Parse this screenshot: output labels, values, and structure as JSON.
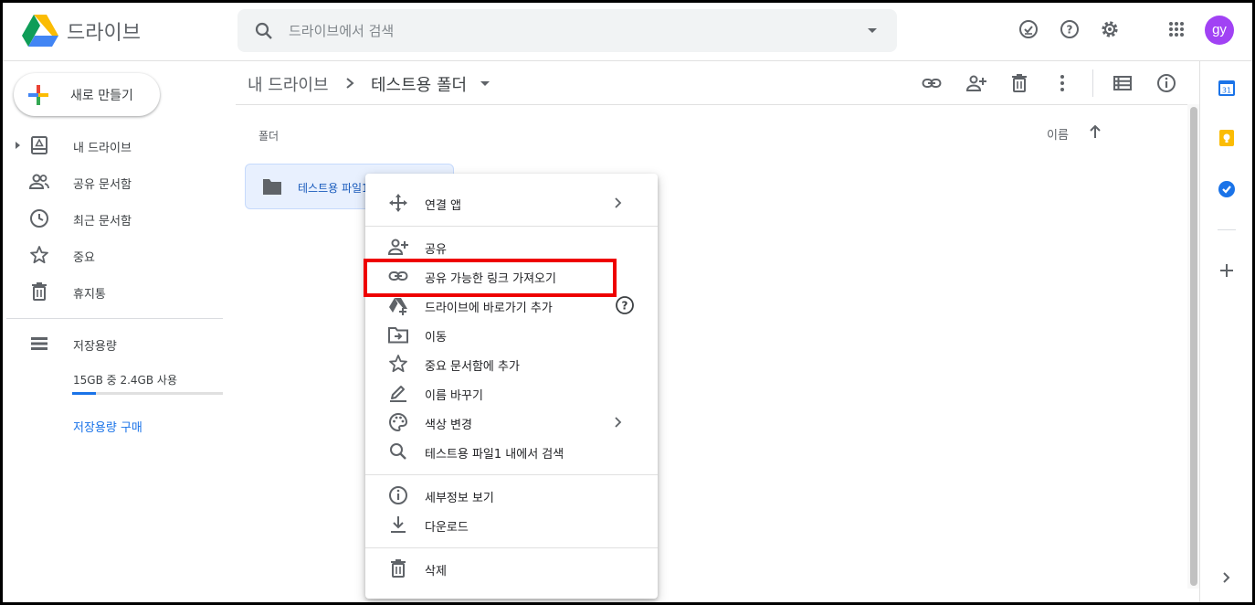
{
  "app": {
    "title": "드라이브"
  },
  "search": {
    "placeholder": "드라이브에서 검색"
  },
  "header_icons": [
    "offline-status-icon",
    "help-icon",
    "settings-icon",
    "apps-grid-icon"
  ],
  "user": {
    "initials": "gy",
    "avatar_color": "#a142f4"
  },
  "new_button": {
    "label": "새로 만들기"
  },
  "sidebar": {
    "items": [
      {
        "label": "내 드라이브",
        "icon": "my-drive-icon"
      },
      {
        "label": "공유 문서함",
        "icon": "shared-icon"
      },
      {
        "label": "최근 문서함",
        "icon": "clock-icon"
      },
      {
        "label": "중요",
        "icon": "star-icon"
      },
      {
        "label": "휴지통",
        "icon": "trash-icon"
      }
    ],
    "storage": {
      "label": "저장용량",
      "usage": "15GB 중 2.4GB 사용",
      "used_fraction": 0.16,
      "buy_label": "저장용량 구매"
    }
  },
  "breadcrumb": {
    "parent": "내 드라이브",
    "current": "테스트용 폴더"
  },
  "toolbar_icons": [
    "link-icon",
    "add-person-icon",
    "trash-icon",
    "more-vert-icon",
    "list-view-icon",
    "info-icon"
  ],
  "content": {
    "section_label": "폴더",
    "sort_label": "이름",
    "folders": [
      {
        "name": "테스트용 파일1"
      }
    ]
  },
  "context_menu": {
    "items": [
      {
        "label": "연결 앱",
        "icon": "open-with-icon",
        "submenu": true
      },
      {
        "label": "공유",
        "icon": "add-person-icon"
      },
      {
        "label": "공유 가능한 링크 가져오기",
        "icon": "link-icon",
        "highlighted": true
      },
      {
        "label": "드라이브에 바로가기 추가",
        "icon": "drive-shortcut-icon",
        "help": true
      },
      {
        "label": "이동",
        "icon": "move-folder-icon"
      },
      {
        "label": "중요 문서함에 추가",
        "icon": "star-icon"
      },
      {
        "label": "이름 바꾸기",
        "icon": "edit-icon"
      },
      {
        "label": "색상 변경",
        "icon": "palette-icon",
        "submenu": true
      },
      {
        "label": "테스트용 파일1 내에서 검색",
        "icon": "search-icon"
      },
      {
        "label": "세부정보 보기",
        "icon": "info-icon"
      },
      {
        "label": "다운로드",
        "icon": "download-icon"
      },
      {
        "label": "삭제",
        "icon": "trash-icon"
      }
    ]
  },
  "side_panel": {
    "calendar_day": "31"
  },
  "colors": {
    "accent": "#1a73e8",
    "highlight_box": "#ee0000",
    "selected_bg": "#e8f0fe"
  }
}
